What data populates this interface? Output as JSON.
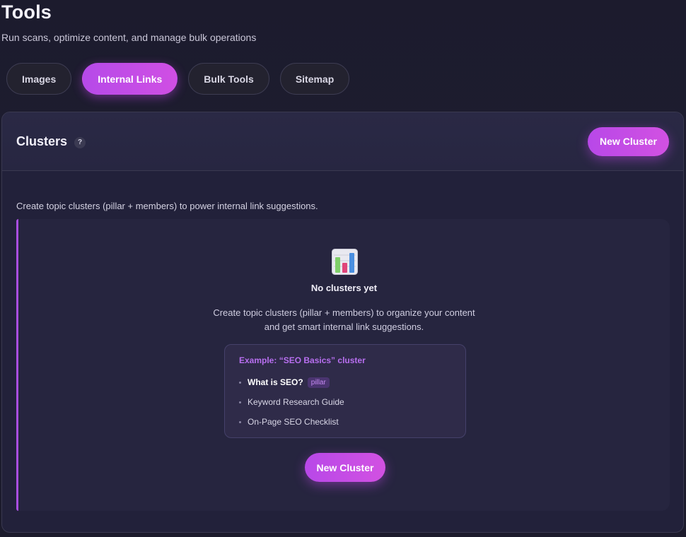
{
  "page": {
    "title": "Tools",
    "subtitle": "Run scans, optimize content, and manage bulk operations"
  },
  "tabs": [
    {
      "label": "Images",
      "active": false
    },
    {
      "label": "Internal Links",
      "active": true
    },
    {
      "label": "Bulk Tools",
      "active": false
    },
    {
      "label": "Sitemap",
      "active": false
    }
  ],
  "panel": {
    "title": "Clusters",
    "help_icon": "?",
    "new_cluster_label": "New Cluster",
    "description": "Create topic clusters (pillar + members) to power internal link suggestions."
  },
  "empty_state": {
    "icon": "bar-chart-icon",
    "title": "No clusters yet",
    "description_line1": "Create topic clusters (pillar + members) to organize your content",
    "description_line2": "and get smart internal link suggestions.",
    "example": {
      "title": "Example: “SEO Basics” cluster",
      "items": [
        {
          "label": "What is SEO?",
          "badge": "pillar"
        },
        {
          "label": "Keyword Research Guide"
        },
        {
          "label": "On-Page SEO Checklist"
        }
      ]
    },
    "button_label": "New Cluster"
  },
  "colors": {
    "accent": "#c04de6",
    "background": "#1c1b2d",
    "panel": "#22213a"
  }
}
